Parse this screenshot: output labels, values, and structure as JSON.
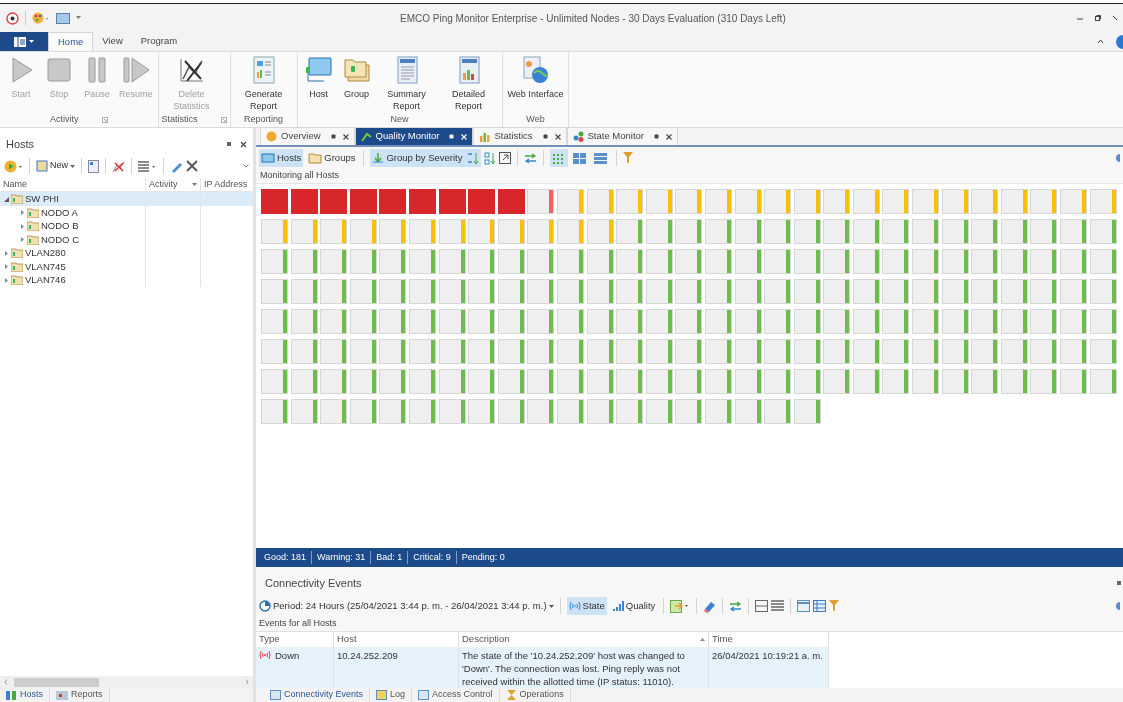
{
  "window": {
    "title": "EMCO Ping Monitor Enterprise - Unlimited Nodes - 30 Days Evaluation (310 Days Left)"
  },
  "ribbon": {
    "tabs": [
      {
        "label": "Home",
        "selected": true
      },
      {
        "label": "View",
        "selected": false
      },
      {
        "label": "Program",
        "selected": false
      }
    ],
    "groups": [
      {
        "label": "Activity",
        "launcher": true,
        "buttons": [
          {
            "label": "Start",
            "disabled": true
          },
          {
            "label": "Stop",
            "disabled": true
          },
          {
            "label": "Pause",
            "disabled": true
          },
          {
            "label": "Resume",
            "disabled": true
          }
        ]
      },
      {
        "label": "Statistics",
        "launcher": true,
        "buttons": [
          {
            "label": "Delete Statistics",
            "disabled": true
          }
        ]
      },
      {
        "label": "Reporting",
        "launcher": false,
        "buttons": [
          {
            "label": "Generate Report",
            "disabled": false
          }
        ]
      },
      {
        "label": "New",
        "launcher": false,
        "buttons": [
          {
            "label": "Host",
            "disabled": false
          },
          {
            "label": "Group",
            "disabled": false
          },
          {
            "label": "Summary Report",
            "disabled": false
          },
          {
            "label": "Detailed Report",
            "disabled": false
          }
        ]
      },
      {
        "label": "Web",
        "launcher": false,
        "buttons": [
          {
            "label": "Web Interface",
            "disabled": false
          }
        ]
      }
    ]
  },
  "hosts_panel": {
    "title": "Hosts",
    "new_button": "New",
    "columns": [
      "Name",
      "Activity",
      "IP Address"
    ],
    "tree": [
      {
        "label": "SW PHI",
        "expanded": true,
        "selected": true,
        "children": [
          {
            "label": "NODO A",
            "expanded": false,
            "selected": false
          },
          {
            "label": "NODO B",
            "expanded": false,
            "selected": false
          },
          {
            "label": "NODO C",
            "expanded": false,
            "selected": false
          }
        ]
      },
      {
        "label": "VLAN280",
        "expanded": false,
        "selected": false
      },
      {
        "label": "VLAN745",
        "expanded": false,
        "selected": false
      },
      {
        "label": "VLAN746",
        "expanded": false,
        "selected": false
      }
    ],
    "bottom_tabs": [
      {
        "label": "Hosts",
        "selected": true
      },
      {
        "label": "Reports",
        "selected": false
      }
    ]
  },
  "document_tabs": [
    {
      "label": "Overview",
      "selected": false
    },
    {
      "label": "Quality Monitor",
      "selected": true
    },
    {
      "label": "Statistics",
      "selected": false
    },
    {
      "label": "State Monitor",
      "selected": false
    }
  ],
  "quality_monitor": {
    "view_buttons": [
      {
        "label": "Hosts",
        "selected": true
      },
      {
        "label": "Groups",
        "selected": false
      }
    ],
    "group_button": {
      "label": "Group by Severity",
      "selected": true
    },
    "layouts": [
      {
        "selected": true
      },
      {
        "selected": false
      },
      {
        "selected": false
      }
    ],
    "caption": "Monitoring all Hosts",
    "tiles": [
      {
        "kind": "critical"
      },
      {
        "kind": "critical"
      },
      {
        "kind": "critical"
      },
      {
        "kind": "critical"
      },
      {
        "kind": "critical"
      },
      {
        "kind": "critical"
      },
      {
        "kind": "critical"
      },
      {
        "kind": "critical"
      },
      {
        "kind": "critical"
      },
      {
        "kind": "bad"
      },
      {
        "kind": "warning"
      },
      {
        "kind": "warning"
      },
      {
        "kind": "warning"
      },
      {
        "kind": "warning"
      },
      {
        "kind": "warning"
      },
      {
        "kind": "warning"
      },
      {
        "kind": "warning"
      },
      {
        "kind": "warning"
      },
      {
        "kind": "warning"
      },
      {
        "kind": "warning"
      },
      {
        "kind": "warning"
      },
      {
        "kind": "warning"
      },
      {
        "kind": "warning"
      },
      {
        "kind": "warning"
      },
      {
        "kind": "warning"
      },
      {
        "kind": "warning"
      },
      {
        "kind": "warning"
      },
      {
        "kind": "warning"
      },
      {
        "kind": "warning"
      },
      {
        "kind": "warning"
      },
      {
        "kind": "warning"
      },
      {
        "kind": "warning"
      },
      {
        "kind": "warning"
      },
      {
        "kind": "warning"
      },
      {
        "kind": "warning"
      },
      {
        "kind": "warning"
      },
      {
        "kind": "warning"
      },
      {
        "kind": "warning"
      },
      {
        "kind": "warning"
      },
      {
        "kind": "warning"
      },
      {
        "kind": "warning"
      },
      {
        "kind": "good"
      },
      {
        "kind": "good"
      },
      {
        "kind": "good"
      },
      {
        "kind": "good"
      },
      {
        "kind": "good"
      },
      {
        "kind": "good"
      },
      {
        "kind": "good"
      },
      {
        "kind": "good"
      },
      {
        "kind": "good"
      },
      {
        "kind": "good"
      },
      {
        "kind": "good"
      },
      {
        "kind": "good"
      },
      {
        "kind": "good"
      },
      {
        "kind": "good"
      },
      {
        "kind": "good"
      },
      {
        "kind": "good"
      },
      {
        "kind": "good"
      },
      {
        "kind": "good"
      },
      {
        "kind": "good"
      },
      {
        "kind": "good"
      },
      {
        "kind": "good"
      },
      {
        "kind": "good"
      },
      {
        "kind": "good"
      },
      {
        "kind": "good"
      },
      {
        "kind": "good"
      },
      {
        "kind": "good"
      },
      {
        "kind": "good"
      },
      {
        "kind": "good"
      },
      {
        "kind": "good"
      },
      {
        "kind": "good"
      },
      {
        "kind": "good"
      },
      {
        "kind": "good"
      },
      {
        "kind": "good"
      },
      {
        "kind": "good"
      },
      {
        "kind": "good"
      },
      {
        "kind": "good"
      },
      {
        "kind": "good"
      },
      {
        "kind": "good"
      },
      {
        "kind": "good"
      },
      {
        "kind": "good"
      },
      {
        "kind": "good"
      },
      {
        "kind": "good"
      },
      {
        "kind": "good"
      },
      {
        "kind": "good"
      },
      {
        "kind": "good"
      },
      {
        "kind": "good"
      },
      {
        "kind": "good"
      },
      {
        "kind": "good"
      },
      {
        "kind": "good"
      },
      {
        "kind": "good"
      },
      {
        "kind": "good"
      },
      {
        "kind": "good"
      },
      {
        "kind": "good"
      },
      {
        "kind": "good"
      },
      {
        "kind": "good"
      },
      {
        "kind": "good"
      },
      {
        "kind": "good"
      },
      {
        "kind": "good"
      },
      {
        "kind": "good"
      },
      {
        "kind": "good"
      },
      {
        "kind": "good"
      },
      {
        "kind": "good"
      },
      {
        "kind": "good"
      },
      {
        "kind": "good"
      },
      {
        "kind": "good"
      },
      {
        "kind": "good"
      },
      {
        "kind": "good"
      },
      {
        "kind": "good"
      },
      {
        "kind": "good"
      },
      {
        "kind": "good"
      },
      {
        "kind": "good"
      },
      {
        "kind": "good"
      },
      {
        "kind": "good"
      },
      {
        "kind": "good"
      },
      {
        "kind": "good"
      },
      {
        "kind": "good"
      },
      {
        "kind": "good"
      },
      {
        "kind": "good"
      },
      {
        "kind": "good"
      },
      {
        "kind": "good"
      },
      {
        "kind": "good"
      },
      {
        "kind": "good"
      },
      {
        "kind": "good"
      },
      {
        "kind": "good"
      },
      {
        "kind": "good"
      },
      {
        "kind": "good"
      },
      {
        "kind": "good"
      },
      {
        "kind": "good"
      },
      {
        "kind": "good"
      },
      {
        "kind": "good"
      },
      {
        "kind": "good"
      },
      {
        "kind": "good"
      },
      {
        "kind": "good"
      },
      {
        "kind": "good"
      },
      {
        "kind": "good"
      },
      {
        "kind": "good"
      },
      {
        "kind": "good"
      },
      {
        "kind": "good"
      },
      {
        "kind": "good"
      },
      {
        "kind": "good"
      },
      {
        "kind": "good"
      },
      {
        "kind": "good"
      },
      {
        "kind": "good"
      },
      {
        "kind": "good"
      },
      {
        "kind": "good"
      },
      {
        "kind": "good"
      },
      {
        "kind": "good"
      },
      {
        "kind": "good"
      },
      {
        "kind": "good"
      },
      {
        "kind": "good"
      },
      {
        "kind": "good"
      },
      {
        "kind": "good"
      },
      {
        "kind": "good"
      },
      {
        "kind": "good"
      },
      {
        "kind": "good"
      },
      {
        "kind": "good"
      },
      {
        "kind": "good"
      },
      {
        "kind": "good"
      },
      {
        "kind": "good"
      },
      {
        "kind": "good"
      },
      {
        "kind": "good"
      },
      {
        "kind": "good"
      },
      {
        "kind": "good"
      },
      {
        "kind": "good"
      },
      {
        "kind": "good"
      },
      {
        "kind": "good"
      },
      {
        "kind": "good"
      },
      {
        "kind": "good"
      },
      {
        "kind": "good"
      },
      {
        "kind": "good"
      },
      {
        "kind": "good"
      },
      {
        "kind": "good"
      },
      {
        "kind": "good"
      },
      {
        "kind": "good"
      },
      {
        "kind": "good"
      },
      {
        "kind": "good"
      },
      {
        "kind": "good"
      },
      {
        "kind": "good"
      },
      {
        "kind": "good"
      },
      {
        "kind": "good"
      },
      {
        "kind": "good"
      },
      {
        "kind": "good"
      },
      {
        "kind": "good"
      },
      {
        "kind": "good"
      },
      {
        "kind": "good"
      },
      {
        "kind": "good"
      },
      {
        "kind": "good"
      },
      {
        "kind": "good"
      },
      {
        "kind": "good"
      },
      {
        "kind": "good"
      },
      {
        "kind": "good"
      },
      {
        "kind": "good"
      },
      {
        "kind": "good"
      },
      {
        "kind": "good"
      },
      {
        "kind": "good"
      },
      {
        "kind": "good"
      },
      {
        "kind": "good"
      },
      {
        "kind": "good"
      },
      {
        "kind": "good"
      },
      {
        "kind": "good"
      },
      {
        "kind": "good"
      },
      {
        "kind": "good"
      },
      {
        "kind": "good"
      },
      {
        "kind": "good"
      },
      {
        "kind": "good"
      },
      {
        "kind": "good"
      },
      {
        "kind": "good"
      },
      {
        "kind": "good"
      },
      {
        "kind": "good"
      },
      {
        "kind": "good"
      },
      {
        "kind": "good"
      },
      {
        "kind": "good"
      },
      {
        "kind": "good"
      },
      {
        "kind": "good"
      },
      {
        "kind": "good"
      },
      {
        "kind": "good"
      },
      {
        "kind": "good"
      },
      {
        "kind": "good"
      },
      {
        "kind": "good"
      },
      {
        "kind": "good"
      },
      {
        "kind": "good"
      }
    ],
    "status_bar": [
      "Good: 181",
      "Warning: 31",
      "Bad: 1",
      "Critical: 9",
      "Pending: 0"
    ]
  },
  "events_panel": {
    "title": "Connectivity Events",
    "period": "Period: 24 Hours (25/04/2021 3:44 p. m. - 26/04/2021 3:44 p. m.)",
    "modes": [
      {
        "label": "State",
        "selected": true
      },
      {
        "label": "Quality",
        "selected": false
      }
    ],
    "caption": "Events for all Hosts",
    "columns": [
      "Type",
      "Host",
      "Description",
      "Time"
    ],
    "rows": [
      {
        "type": "Down",
        "host": "10.24.252.209",
        "description": "The state of the '10.24.252.209' host was changed to 'Down'. The connection was lost. Ping reply was not received within the allotted time (IP status: 11010).",
        "time": "26/04/2021 10:19:21 a. m.",
        "selected": true
      }
    ],
    "tabs": [
      {
        "label": "Connectivity Events",
        "selected": true
      },
      {
        "label": "Log",
        "selected": false
      },
      {
        "label": "Access Control",
        "selected": false
      },
      {
        "label": "Operations",
        "selected": false
      }
    ]
  }
}
